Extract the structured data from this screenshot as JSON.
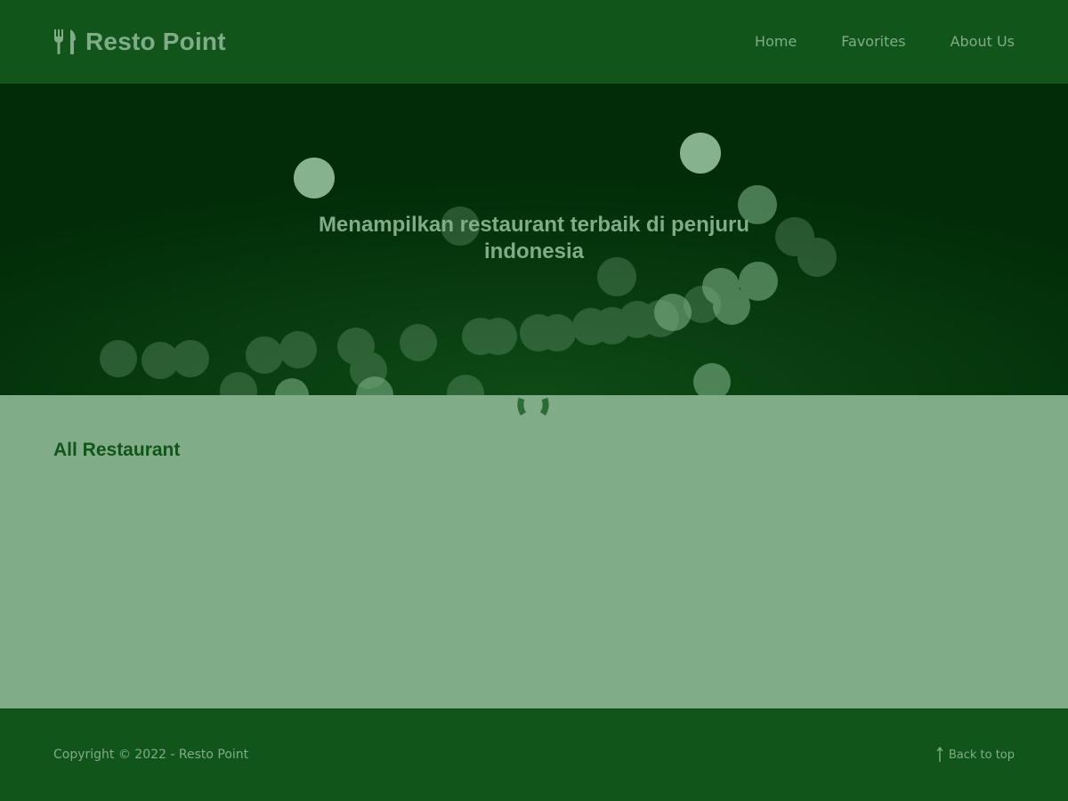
{
  "header": {
    "brand_icon": "utensils-icon",
    "brand_name": "Resto Point",
    "nav": [
      {
        "label": "Home"
      },
      {
        "label": "Favorites"
      },
      {
        "label": "About Us"
      }
    ]
  },
  "hero": {
    "tagline": "Menampilkan restaurant terbaik di penjuru indonesia",
    "background": "bokeh-lights-image"
  },
  "main": {
    "loader_icon": "loading-spinner-icon",
    "section_title": "All Restaurant"
  },
  "footer": {
    "copyright": "Copyright © 2022 - Resto Point",
    "back_to_top_icon": "arrow-up-icon",
    "back_to_top": "Back to top"
  },
  "colors": {
    "header_bg": "#11551b",
    "hero_bg": "#012c07",
    "page_bg": "#80ac88",
    "text_light": "#80ac88",
    "text_dark": "#11551b"
  }
}
